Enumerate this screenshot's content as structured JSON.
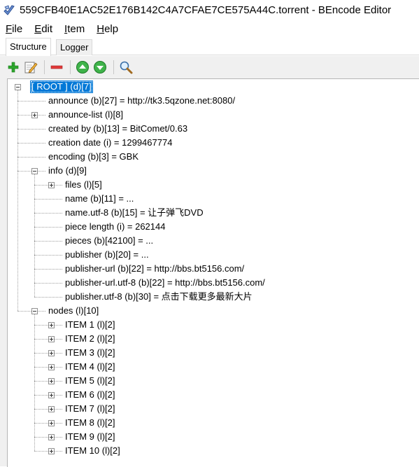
{
  "window": {
    "title": "559CFB40E1AC52E176B142C4A7CFAE7CE575A44C.torrent - BEncode Editor",
    "app_icon": "bencode-editor-icon"
  },
  "menu": [
    {
      "label_pre": "",
      "label_u": "F",
      "label_post": "ile"
    },
    {
      "label_pre": "",
      "label_u": "E",
      "label_post": "dit"
    },
    {
      "label_pre": "",
      "label_u": "I",
      "label_post": "tem"
    },
    {
      "label_pre": "",
      "label_u": "H",
      "label_post": "elp"
    }
  ],
  "tabs": [
    {
      "label": "Structure",
      "active": true
    },
    {
      "label": "Logger",
      "active": false
    }
  ],
  "toolbar": {
    "icons": [
      "add-icon",
      "edit-icon",
      "remove-icon",
      "move-up-icon",
      "move-down-icon",
      "search-icon"
    ]
  },
  "tree": [
    {
      "label": "[ ROOT ] (d)[7]",
      "depth": 0,
      "expander": "minus",
      "selected": true
    },
    {
      "label": "announce (b)[27] = http://tk3.5qzone.net:8080/",
      "depth": 1,
      "expander": "none"
    },
    {
      "label": "announce-list (l)[8]",
      "depth": 1,
      "expander": "plus"
    },
    {
      "label": "created by (b)[13] = BitComet/0.63",
      "depth": 1,
      "expander": "none"
    },
    {
      "label": "creation date (i) = 1299467774",
      "depth": 1,
      "expander": "none"
    },
    {
      "label": "encoding (b)[3] = GBK",
      "depth": 1,
      "expander": "none"
    },
    {
      "label": "info (d)[9]",
      "depth": 1,
      "expander": "minus"
    },
    {
      "label": "files (l)[5]",
      "depth": 2,
      "expander": "plus"
    },
    {
      "label": "name (b)[11] = ...",
      "depth": 2,
      "expander": "none"
    },
    {
      "label": "name.utf-8 (b)[15] = 让子弹飞DVD",
      "depth": 2,
      "expander": "none"
    },
    {
      "label": "piece length (i) = 262144",
      "depth": 2,
      "expander": "none"
    },
    {
      "label": "pieces (b)[42100] = ...",
      "depth": 2,
      "expander": "none"
    },
    {
      "label": "publisher (b)[20] = ...",
      "depth": 2,
      "expander": "none"
    },
    {
      "label": "publisher-url (b)[22] = http://bbs.bt5156.com/",
      "depth": 2,
      "expander": "none"
    },
    {
      "label": "publisher-url.utf-8 (b)[22] = http://bbs.bt5156.com/",
      "depth": 2,
      "expander": "none"
    },
    {
      "label": "publisher.utf-8 (b)[30] = 点击下载更多最新大片",
      "depth": 2,
      "expander": "none"
    },
    {
      "label": "nodes (l)[10]",
      "depth": 1,
      "expander": "minus"
    },
    {
      "label": "ITEM 1 (l)[2]",
      "depth": 2,
      "expander": "plus"
    },
    {
      "label": "ITEM 2 (l)[2]",
      "depth": 2,
      "expander": "plus"
    },
    {
      "label": "ITEM 3 (l)[2]",
      "depth": 2,
      "expander": "plus"
    },
    {
      "label": "ITEM 4 (l)[2]",
      "depth": 2,
      "expander": "plus"
    },
    {
      "label": "ITEM 5 (l)[2]",
      "depth": 2,
      "expander": "plus"
    },
    {
      "label": "ITEM 6 (l)[2]",
      "depth": 2,
      "expander": "plus"
    },
    {
      "label": "ITEM 7 (l)[2]",
      "depth": 2,
      "expander": "plus"
    },
    {
      "label": "ITEM 8 (l)[2]",
      "depth": 2,
      "expander": "plus"
    },
    {
      "label": "ITEM 9 (l)[2]",
      "depth": 2,
      "expander": "plus"
    },
    {
      "label": "ITEM 10 (l)[2]",
      "depth": 2,
      "expander": "plus"
    }
  ]
}
